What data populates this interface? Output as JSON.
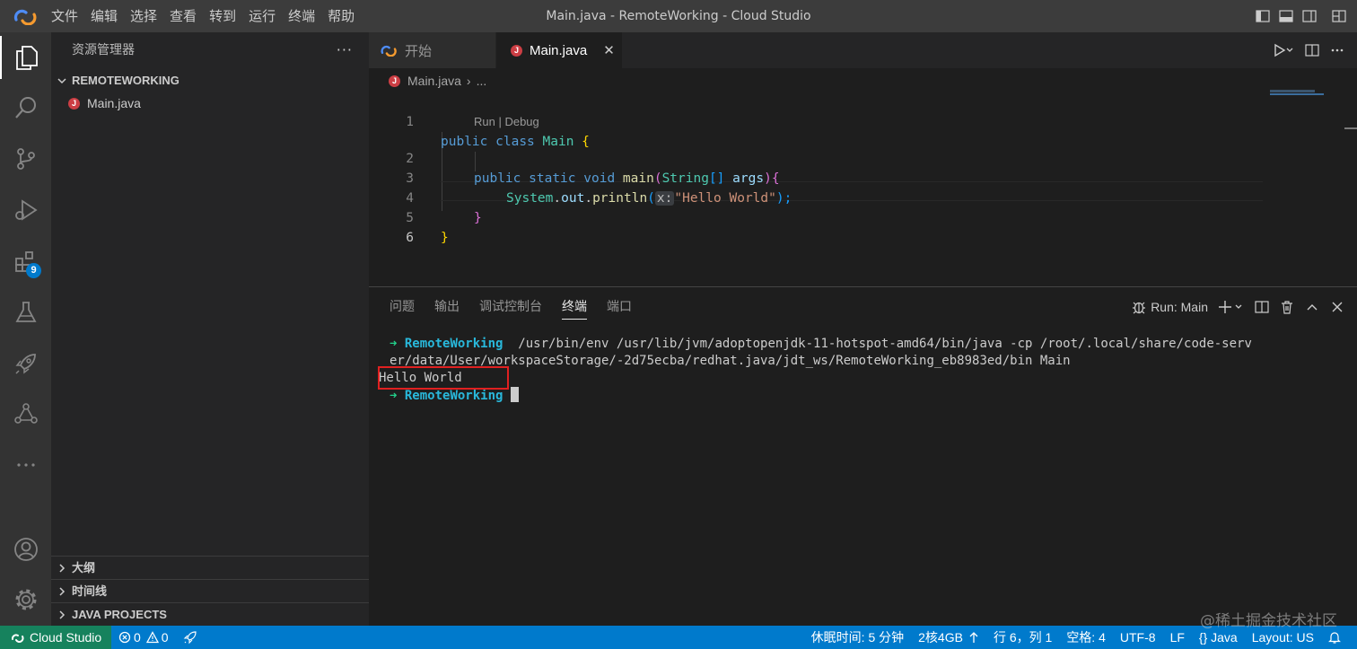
{
  "title_bar": {
    "window_title": "Main.java - RemoteWorking - Cloud Studio",
    "menu": [
      "文件",
      "编辑",
      "选择",
      "查看",
      "转到",
      "运行",
      "终端",
      "帮助"
    ]
  },
  "activity_bar": {
    "extensions_badge": "9"
  },
  "sidebar": {
    "title": "资源管理器",
    "more": "···",
    "folder": "REMOTEWORKING",
    "files": [
      {
        "name": "Main.java",
        "icon": "J"
      }
    ],
    "sections": [
      "大纲",
      "时间线",
      "JAVA PROJECTS"
    ]
  },
  "editor": {
    "tabs": [
      {
        "label": "开始"
      },
      {
        "label": "Main.java",
        "close": "✕"
      }
    ],
    "breadcrumb": {
      "file": "Main.java",
      "sep": "›",
      "more": "..."
    },
    "codelens": "Run | Debug",
    "line_numbers": [
      "1",
      "2",
      "3",
      "4",
      "5",
      "6"
    ],
    "code": {
      "l1": {
        "kw1": "public",
        "kw2": "class",
        "name": "Main",
        "brace": "{"
      },
      "l2": {
        "kw1": "public",
        "kw2": "static",
        "kw3": "void",
        "fn": "main",
        "p1": "(",
        "type": "String",
        "arr": "[]",
        "arg": "args",
        "p2": ")",
        "brace": "{"
      },
      "l3": {
        "cls": "System",
        "dot1": ".",
        "field": "out",
        "dot2": ".",
        "fn": "println",
        "p1": "(",
        "hint": "x:",
        "str": "\"Hello World\"",
        "p2": ");"
      },
      "l4": {
        "brace": "}"
      },
      "l5": {
        "brace": "}"
      }
    }
  },
  "panel": {
    "tabs": [
      "问题",
      "输出",
      "调试控制台",
      "终端",
      "端口"
    ],
    "active_tab": "终端",
    "run_label": "Run: Main",
    "terminal": {
      "prompt_arrow": "➜",
      "cwd": "RemoteWorking",
      "command_line1": "  /usr/bin/env /usr/lib/jvm/adoptopenjdk-11-hotspot-amd64/bin/java -cp /root/.local/share/code-serv",
      "command_line2": "er/data/User/workspaceStorage/-2d75ecba/redhat.java/jdt_ws/RemoteWorking_eb8983ed/bin Main",
      "output": "Hello World"
    }
  },
  "status_bar": {
    "remote": "Cloud Studio",
    "errors": "0",
    "warnings": "0",
    "sleep": "休眠时间: 5 分钟",
    "machine": "2核4GB",
    "position": "行 6，列 1",
    "spaces": "空格: 4",
    "encoding": "UTF-8",
    "eol": "LF",
    "language": "{} Java",
    "layout": "Layout: US"
  },
  "watermark": "@稀土掘金技术社区",
  "colors": {
    "accent": "#007acc",
    "remote": "#16825d",
    "highlight_box": "#e02020"
  }
}
